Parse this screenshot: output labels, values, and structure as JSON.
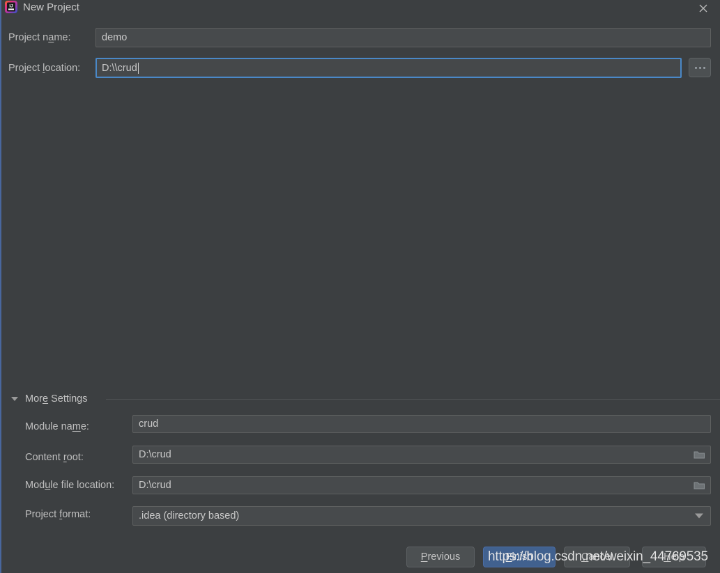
{
  "window": {
    "title": "New Project",
    "app_icon": "intellij-idea-icon",
    "close_icon": "close-icon"
  },
  "form": {
    "project_name": {
      "label_before": "Project n",
      "label_mnemonic": "a",
      "label_after": "me:",
      "value": "demo"
    },
    "project_location": {
      "label_before": "Project ",
      "label_mnemonic": "l",
      "label_after": "ocation:",
      "value": "D:\\\\crud",
      "focused": true
    },
    "browse_button": {
      "label": "...",
      "icon": "ellipsis-icon"
    }
  },
  "more_settings": {
    "label_before": "Mor",
    "label_mnemonic": "e",
    "label_after": " Settings",
    "expanded": true,
    "triangle_icon": "chevron-down-icon",
    "fields": [
      {
        "name": "module-name",
        "label_before": "Module na",
        "label_mnemonic": "m",
        "label_after": "e:",
        "value": "crud",
        "has_folder_icon": false,
        "has_combo_arrow": false
      },
      {
        "name": "content-root",
        "label_before": "Content ",
        "label_mnemonic": "r",
        "label_after": "oot:",
        "value": "D:\\crud",
        "has_folder_icon": true,
        "has_combo_arrow": false
      },
      {
        "name": "module-file-location",
        "label_before": "Mod",
        "label_mnemonic": "u",
        "label_after": "le file location:",
        "value": "D:\\crud",
        "has_folder_icon": true,
        "has_combo_arrow": false
      },
      {
        "name": "project-format",
        "label_before": "Project ",
        "label_mnemonic": "f",
        "label_after": "ormat:",
        "value": ".idea (directory based)",
        "has_folder_icon": false,
        "has_combo_arrow": true
      }
    ]
  },
  "buttons": {
    "previous": {
      "before": "",
      "mnemonic": "P",
      "after": "revious"
    },
    "finish": {
      "before": "",
      "mnemonic": "F",
      "after": "inish"
    },
    "cancel": {
      "before": "",
      "mnemonic": "C",
      "after": "ancel"
    },
    "help": {
      "before": "",
      "mnemonic": "H",
      "after": "elp"
    }
  },
  "watermark": {
    "text": "https://blog.csdn.net/weixin_44769535"
  },
  "colors": {
    "background": "#3c3f41",
    "field_background": "#474a4c",
    "field_border": "#5e6060",
    "focus_border": "#4a88c7",
    "primary_button": "#41618f",
    "text": "#bfbfbf",
    "accent_edge": "#4b6eaf"
  }
}
